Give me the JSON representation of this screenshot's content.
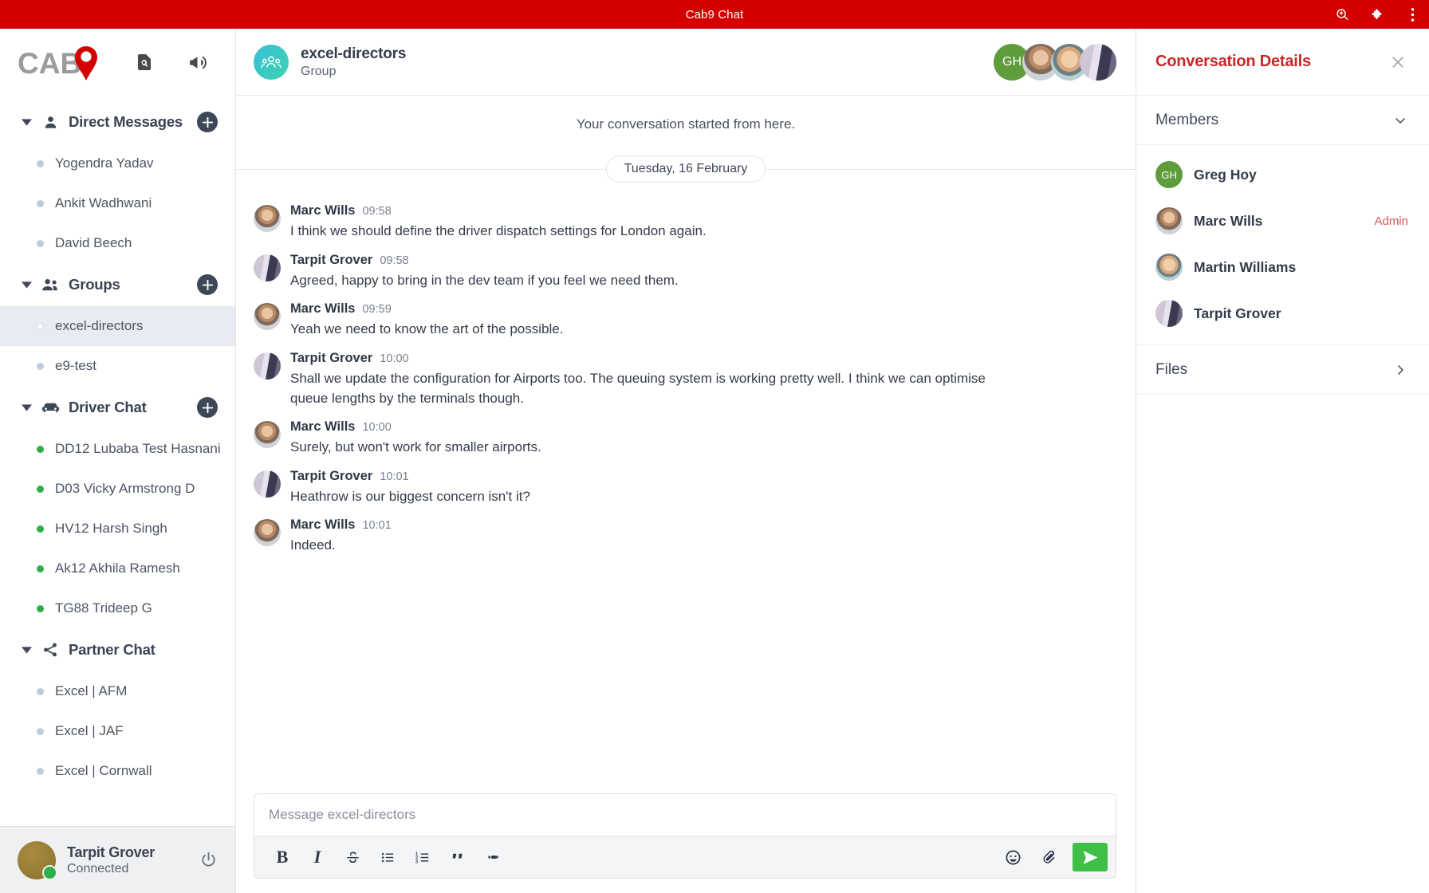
{
  "titlebar": {
    "title": "Cab9 Chat",
    "actions": [
      {
        "name": "search-zoom-icon",
        "label": "Search"
      },
      {
        "name": "extension-puzzle-icon",
        "label": "Extensions"
      },
      {
        "name": "overflow-menu-icon",
        "label": "More"
      }
    ]
  },
  "brand": {
    "logo_text": "CAB",
    "logo_digit": "9",
    "accent": "#d40000",
    "gray": "#9b9b9b"
  },
  "sidebar": {
    "top_icons": [
      {
        "name": "document-search-icon",
        "label": "Find document"
      },
      {
        "name": "megaphone-icon",
        "label": "Announcements"
      }
    ],
    "sections": [
      {
        "id": "direct-messages",
        "title": "Direct Messages",
        "icon": "person-icon",
        "add_label": "+",
        "items": [
          {
            "label": "Yogendra Yadav",
            "status": "offline",
            "active": false
          },
          {
            "label": "Ankit Wadhwani",
            "status": "offline",
            "active": false
          },
          {
            "label": "David Beech",
            "status": "offline",
            "active": false
          }
        ]
      },
      {
        "id": "groups",
        "title": "Groups",
        "icon": "people-icon",
        "add_label": "+",
        "items": [
          {
            "label": "excel-directors",
            "status": "offline",
            "active": true
          },
          {
            "label": "e9-test",
            "status": "offline",
            "active": false
          }
        ]
      },
      {
        "id": "driver-chat",
        "title": "Driver Chat",
        "icon": "car-icon",
        "add_label": "+",
        "items": [
          {
            "label": "DD12 Lubaba Test Hasnani",
            "status": "online",
            "active": false
          },
          {
            "label": "D03 Vicky Armstrong D",
            "status": "online",
            "active": false
          },
          {
            "label": "HV12 Harsh Singh",
            "status": "online",
            "active": false
          },
          {
            "label": "Ak12 Akhila Ramesh",
            "status": "online",
            "active": false
          },
          {
            "label": "TG88 Trideep G",
            "status": "online",
            "active": false
          }
        ]
      },
      {
        "id": "partner-chat",
        "title": "Partner Chat",
        "icon": "share-icon",
        "add_label": "+",
        "items": [
          {
            "label": "Excel | AFM",
            "status": "offline",
            "active": false
          },
          {
            "label": "Excel | JAF",
            "status": "offline",
            "active": false
          },
          {
            "label": "Excel | Cornwall",
            "status": "offline",
            "active": false
          }
        ]
      }
    ],
    "footer": {
      "name": "Tarpit Grover",
      "status": "Connected",
      "presence_color": "#2cb04a",
      "power_icon": "power-icon"
    }
  },
  "chat": {
    "header": {
      "avatar_icon": "group-people-icon",
      "name": "excel-directors",
      "subtitle": "Group",
      "participants": [
        {
          "initials": "GH",
          "kind": "initials",
          "style": "ph-greg"
        },
        {
          "initials": "",
          "kind": "photo",
          "style": "ph-marc"
        },
        {
          "initials": "",
          "kind": "photo",
          "style": "ph-martin"
        },
        {
          "initials": "",
          "kind": "photo",
          "style": "ph-tarpit"
        }
      ]
    },
    "conversation_start": "Your conversation started from here.",
    "date_divider": "Tuesday, 16 February",
    "messages": [
      {
        "author": "Marc Wills",
        "time": "09:58",
        "text": "I think we should define the driver dispatch settings for London again.",
        "style": "ph-marc"
      },
      {
        "author": "Tarpit Grover",
        "time": "09:58",
        "text": "Agreed, happy to bring in the dev team if you feel we need them.",
        "style": "ph-tarpit"
      },
      {
        "author": "Marc Wills",
        "time": "09:59",
        "text": "Yeah we need to know the art of the possible.",
        "style": "ph-marc"
      },
      {
        "author": "Tarpit Grover",
        "time": "10:00",
        "text": "Shall we update the configuration for Airports too. The queuing system is working pretty well. I think we can optimise queue lengths by the terminals though.",
        "style": "ph-tarpit"
      },
      {
        "author": "Marc Wills",
        "time": "10:00",
        "text": "Surely, but won't work for smaller airports.",
        "style": "ph-marc"
      },
      {
        "author": "Tarpit Grover",
        "time": "10:01",
        "text": "Heathrow is our biggest concern isn't it?",
        "style": "ph-tarpit"
      },
      {
        "author": "Marc Wills",
        "time": "10:01",
        "text": "Indeed.",
        "style": "ph-marc"
      }
    ],
    "composer": {
      "placeholder": "Message excel-directors",
      "value": "",
      "tools": [
        {
          "name": "bold-button",
          "label": "B"
        },
        {
          "name": "italic-button",
          "label": "I"
        },
        {
          "name": "strikethrough-button",
          "label": "S"
        },
        {
          "name": "bulleted-list-button",
          "label": "•"
        },
        {
          "name": "numbered-list-button",
          "label": "1."
        },
        {
          "name": "blockquote-button",
          "label": "”"
        },
        {
          "name": "link-button",
          "label": "link"
        }
      ],
      "right_tools": [
        {
          "name": "emoji-button",
          "label": "emoji"
        },
        {
          "name": "attachment-button",
          "label": "attach"
        }
      ],
      "send_label": "Send",
      "send_color": "#3fbf45"
    }
  },
  "details": {
    "title": "Conversation Details",
    "title_color": "#c62828",
    "close_label": "Close",
    "members_header": "Members",
    "members": [
      {
        "name": "Greg Hoy",
        "initials": "GH",
        "role": "",
        "kind": "initials",
        "style": "ph-greg"
      },
      {
        "name": "Marc Wills",
        "initials": "",
        "role": "Admin",
        "kind": "photo",
        "style": "ph-marc"
      },
      {
        "name": "Martin Williams",
        "initials": "",
        "role": "",
        "kind": "photo",
        "style": "ph-martin"
      },
      {
        "name": "Tarpit Grover",
        "initials": "",
        "role": "",
        "kind": "photo",
        "style": "ph-tarpit"
      }
    ],
    "files_label": "Files"
  }
}
